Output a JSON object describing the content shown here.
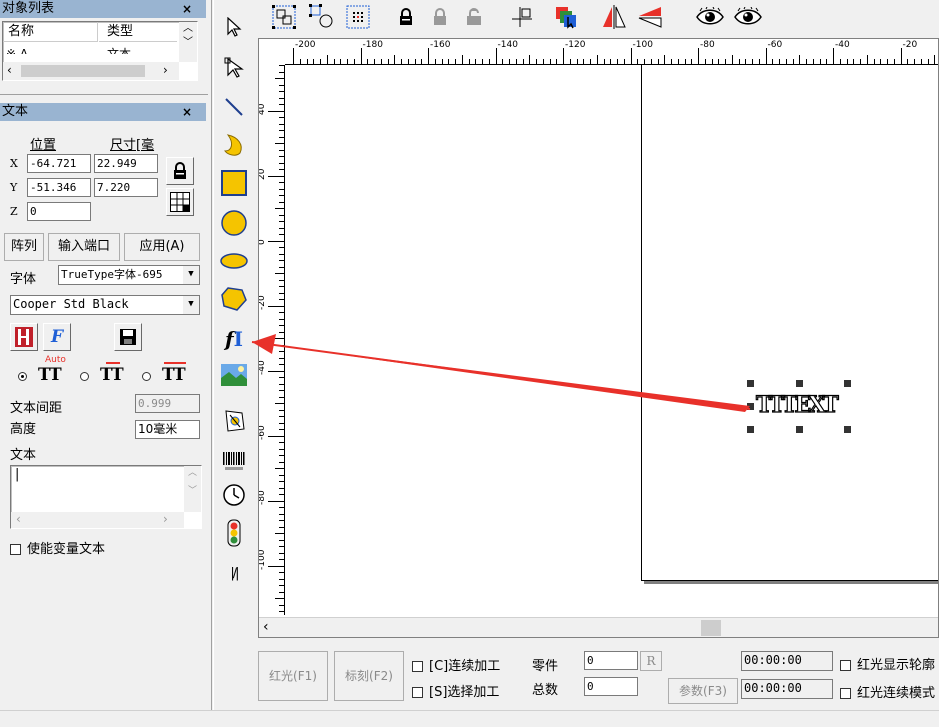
{
  "object_list": {
    "title": "对象列表",
    "close": "×",
    "col_name": "名称",
    "col_type": "类型",
    "row_name": "※ A",
    "row_type": "文本"
  },
  "text_panel": {
    "title": "文本",
    "close": "×",
    "pos_label": "位置",
    "size_label": "尺寸[毫",
    "x_label": "X",
    "y_label": "Y",
    "z_label": "Z",
    "x_pos": "-64.721",
    "y_pos": "-51.346",
    "z_pos": "0",
    "width": "22.949",
    "height": "7.220",
    "array_btn": "阵列",
    "input_port_btn": "输入端口",
    "apply_btn": "应用(A)",
    "font_label": "字体",
    "font_type": "TrueType字体-695",
    "font_name": "Cooper Std Black",
    "auto_label": "Auto",
    "spacing_label": "文本间距",
    "spacing_value": "0.999",
    "height_label": "高度",
    "height_value": "10毫米",
    "text_label": "文本",
    "text_value": "|",
    "variable_text_label": "使能变量文本"
  },
  "ruler": {
    "h_labels": [
      "-200",
      "-180",
      "-160",
      "-140",
      "-120",
      "-100",
      "-80",
      "-60",
      "-40",
      "-20"
    ],
    "v_labels": [
      "40",
      "20",
      "0",
      "-20",
      "-40",
      "-60",
      "-80",
      "-100"
    ]
  },
  "canvas": {
    "selected_text": "TTTEXT"
  },
  "bottom": {
    "red_light_btn": "红光(F1)",
    "mark_btn": "标刻(F2)",
    "continuous_label": "[C]连续加工",
    "select_label": "[S]选择加工",
    "parts_label": "零件",
    "total_label": "总数",
    "parts_value": "0",
    "total_value": "0",
    "r_btn": "R",
    "params_btn": "参数(F3)",
    "time1": "00:00:00",
    "time2": "00:00:00",
    "red_outline_label": "红光显示轮廓",
    "red_continuous_label": "红光连续模式"
  },
  "colors": {
    "title_bar": "#99b4d1",
    "arrow": "#e8312a",
    "accent_blue": "#1f5fd6"
  }
}
